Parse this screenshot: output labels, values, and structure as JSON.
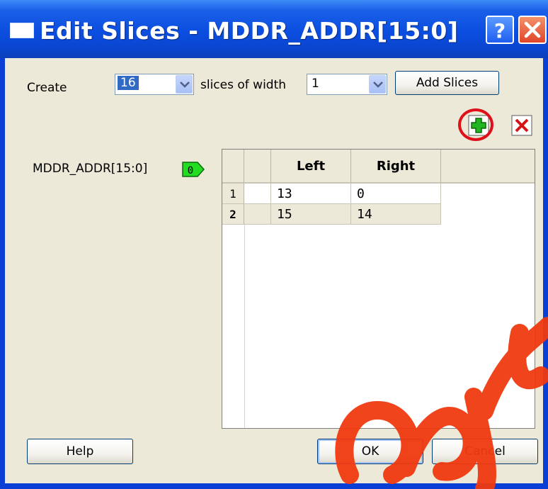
{
  "window": {
    "title": "Edit Slices - MDDR_ADDR[15:0]",
    "help_symbol": "?",
    "close_symbol": "X"
  },
  "create_row": {
    "create_label": "Create",
    "count_value": "16",
    "slices_of_width_label": "slices of width",
    "width_value": "1",
    "add_slices_label": "Add Slices"
  },
  "toolbar": {
    "add_icon": "green-plus-icon",
    "delete_icon": "red-x-icon"
  },
  "signal": {
    "name": "MDDR_ADDR[15:0]",
    "tag_label": "0"
  },
  "grid": {
    "columns": [
      "",
      "Left",
      "Right"
    ],
    "rows": [
      {
        "num": "1",
        "left": "13",
        "right": "0"
      },
      {
        "num": "2",
        "left": "15",
        "right": "14"
      }
    ]
  },
  "footer": {
    "help_label": "Help",
    "ok_label": "OK",
    "cancel_label": "Cancel"
  },
  "colors": {
    "title_bar": "#0b4ee0",
    "dialog_bg": "#ece9d8",
    "accent_red": "#e0101a",
    "tag_green": "#22dd22"
  }
}
